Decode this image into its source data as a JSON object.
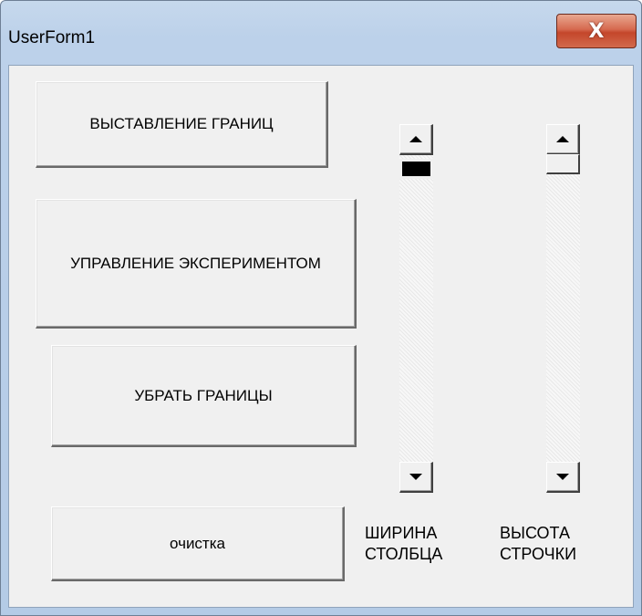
{
  "window": {
    "title": "UserForm1",
    "close_label": "X"
  },
  "buttons": {
    "set_borders": "ВЫСТАВЛЕНИЕ ГРАНИЦ",
    "experiment_control": "УПРАВЛЕНИЕ ЭКСПЕРИМЕНТОМ",
    "remove_borders": "УБРАТЬ ГРАНИЦЫ",
    "clear": "очистка"
  },
  "scrollbars": {
    "column_width": {
      "label_line1": "ШИРИНА",
      "label_line2": "СТОЛБЦА",
      "value_fraction": 0.0
    },
    "row_height": {
      "label_line1": "ВЫСОТА",
      "label_line2": "СТРОЧКИ",
      "value_fraction": 0.0
    }
  },
  "icons": {
    "close": "close-icon",
    "scroll_up": "arrow-up-icon",
    "scroll_down": "arrow-down-icon"
  }
}
